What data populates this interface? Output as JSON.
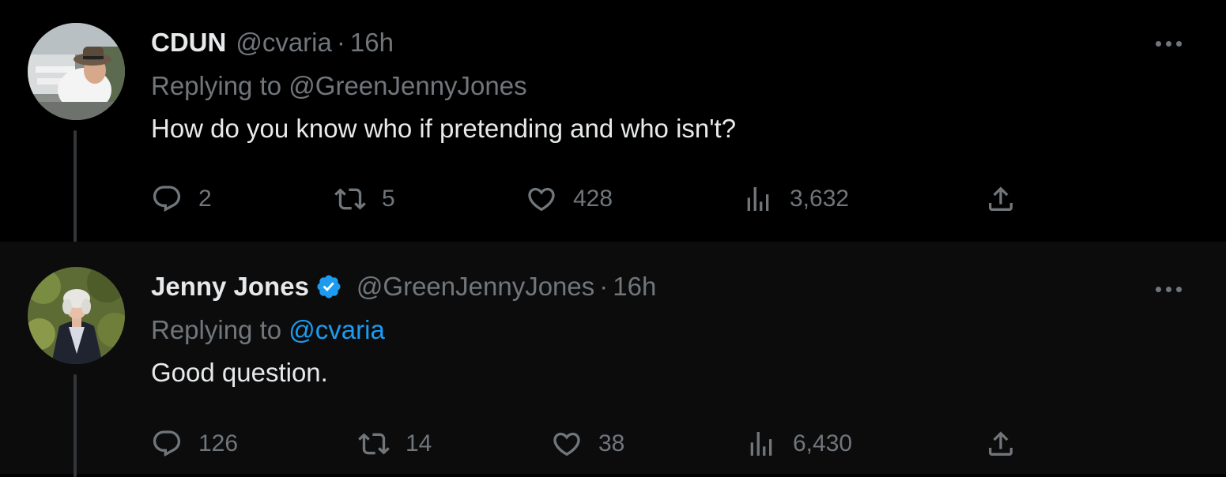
{
  "tweets": [
    {
      "name": "CDUN",
      "handle": "@cvaria",
      "separator": "·",
      "time": "16h",
      "replying_prefix": "Replying to",
      "replying_to": "@GreenJennyJones",
      "text": "How do you know who if pretending and who isn't?",
      "verified": false,
      "stats": {
        "replies": "2",
        "retweets": "5",
        "likes": "428",
        "views": "3,632"
      },
      "icons": [
        "reply-icon",
        "retweet-icon",
        "like-icon",
        "views-icon",
        "share-icon",
        "more-icon"
      ]
    },
    {
      "name": "Jenny Jones",
      "handle": "@GreenJennyJones",
      "separator": "·",
      "time": "16h",
      "replying_prefix": "Replying to",
      "replying_to": "@cvaria",
      "text": "Good question.",
      "verified": true,
      "stats": {
        "replies": "126",
        "retweets": "14",
        "likes": "38",
        "views": "6,430"
      },
      "icons": [
        "reply-icon",
        "retweet-icon",
        "like-icon",
        "views-icon",
        "share-icon",
        "more-icon"
      ]
    }
  ],
  "colors": {
    "background": "#000000",
    "secondary_text": "#71767b",
    "primary_text": "#e7e9ea",
    "link": "#1d9bf0",
    "verified_badge": "#1d9bf0"
  }
}
